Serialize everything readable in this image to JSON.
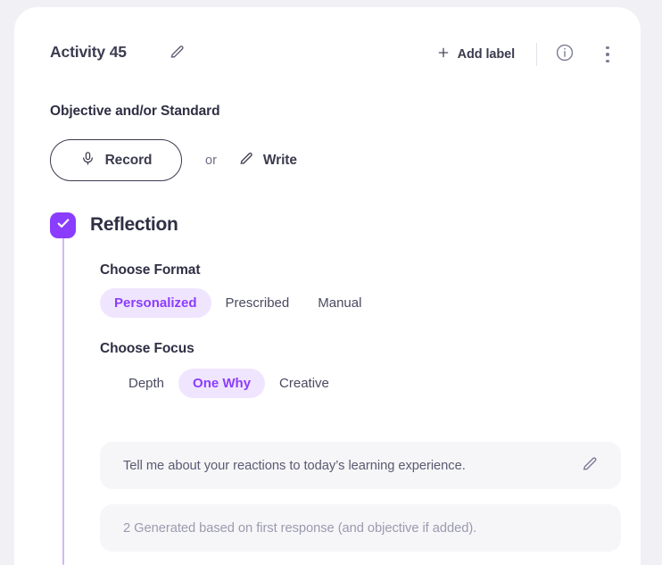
{
  "header": {
    "title": "Activity 45",
    "edit_icon": "pencil-icon",
    "add_label": "Add label",
    "plus_icon": "plus-icon",
    "info_icon": "info-circle-icon",
    "more_icon": "vertical-dots-icon"
  },
  "objective": {
    "heading": "Objective and/or Standard",
    "record_label": "Record",
    "record_icon": "microphone-icon",
    "or_text": "or",
    "write_label": "Write",
    "write_icon": "pencil-icon"
  },
  "reflection": {
    "title": "Reflection",
    "checked": true,
    "check_icon": "checkmark-icon",
    "format": {
      "label": "Choose Format",
      "options": [
        "Personalized",
        "Prescribed",
        "Manual"
      ],
      "selected": "Personalized"
    },
    "focus": {
      "label": "Choose Focus",
      "options": [
        "Depth",
        "One Why",
        "Creative"
      ],
      "selected": "One Why"
    },
    "prompts": [
      {
        "text": "Tell me about your reactions to today’s learning experience.",
        "muted": false,
        "edit_icon": "pencil-icon"
      },
      {
        "text": "2 Generated based on first response (and objective if added).",
        "muted": true
      }
    ]
  },
  "colors": {
    "accent_purple": "#8B3DFF",
    "accent_purple_soft": "#F0E5FE",
    "rail_purple": "#D6B4FB",
    "page_background": "#F1F1F5",
    "card_background": "#FFFFFF",
    "prompt_background": "#F6F6F8",
    "text_dark": "#2F2F44",
    "text_muted": "#9A9AB0"
  }
}
